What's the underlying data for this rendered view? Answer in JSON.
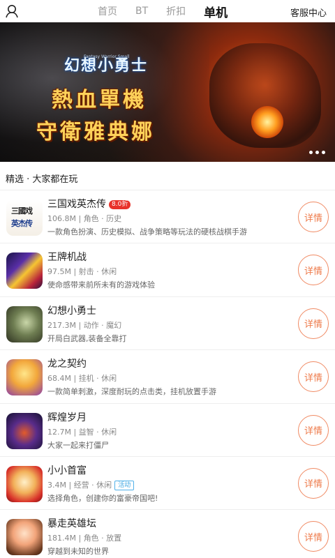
{
  "header": {
    "user_icon": "user-icon",
    "tabs": [
      {
        "label": "首页",
        "active": false
      },
      {
        "label": "BT",
        "active": false
      },
      {
        "label": "折扣",
        "active": false
      },
      {
        "label": "单机",
        "active": true
      }
    ],
    "service_label": "客服中心"
  },
  "banner": {
    "logo_text": "幻想小勇士",
    "logo_sub": "Fantasy Warrior Small",
    "slogan_line1": "熱血單機",
    "slogan_line2": "守衛雅典娜",
    "page_dots": 3
  },
  "section": {
    "title": "精选 · 大家都在玩"
  },
  "games": [
    {
      "name": "三国戏英杰传",
      "badge": "8.0折",
      "size": "106.8M",
      "categories": "角色 · 历史",
      "tag": "",
      "desc": "一款角色扮演、历史模拟、战争策略等玩法的硬核战棋手游",
      "button": "详情",
      "icon": "game-icon-sanguoxi",
      "icon_text_1": "三國戏",
      "icon_text_2": "英杰传"
    },
    {
      "name": "王牌机战",
      "badge": "",
      "size": "97.5M",
      "categories": "射击 · 休闲",
      "tag": "",
      "desc": "使命感带来前所未有的游戏体验",
      "button": "详情",
      "icon": "game-icon-wangpai"
    },
    {
      "name": "幻想小勇士",
      "badge": "",
      "size": "217.3M",
      "categories": "动作 · 魔幻",
      "tag": "",
      "desc": "开局白武器,装备全靠打",
      "button": "详情",
      "icon": "game-icon-huanxiang"
    },
    {
      "name": "龙之契约",
      "badge": "",
      "size": "68.4M",
      "categories": "挂机 · 休闲",
      "tag": "",
      "desc": "一款简单刺激，深度耐玩的点击类，挂机放置手游",
      "button": "详情",
      "icon": "game-icon-longzhi"
    },
    {
      "name": "辉煌岁月",
      "badge": "",
      "size": "12.7M",
      "categories": "益智 · 休闲",
      "tag": "",
      "desc": "大家一起来打僵尸",
      "button": "详情",
      "icon": "game-icon-huihuang"
    },
    {
      "name": "小小首富",
      "badge": "",
      "size": "3.4M",
      "categories": "经营 · 休闲",
      "tag": "活动",
      "desc": "选择角色，创建你的富豪帝国吧!",
      "button": "详情",
      "icon": "game-icon-xiaoxiao"
    },
    {
      "name": "暴走英雄坛",
      "badge": "",
      "size": "181.4M",
      "categories": "角色 · 放置",
      "tag": "",
      "desc": "穿越到未知的世界",
      "button": "详情",
      "icon": "game-icon-baozou"
    }
  ]
}
